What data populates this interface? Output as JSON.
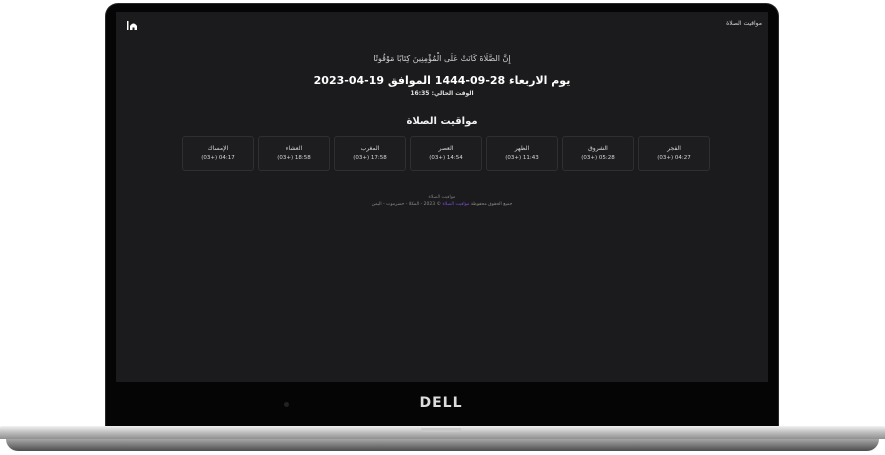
{
  "device": {
    "brand": "DELL"
  },
  "nav": {
    "title": "مواقيت الصلاة",
    "logo_icon": "mosque-icon"
  },
  "hero": {
    "verse": "إِنَّ الصَّلَاةَ كَانَتْ عَلَى الْمُؤْمِنِينَ كِتَابًا مَوْقُوتًا",
    "date": "يوم الاربعاء 28-09-1444 الموافق 19-04-2023",
    "current_time_label": "الوقت الحالي:",
    "current_time": "16:35"
  },
  "prayers": {
    "title": "مواقيت الصلاة",
    "items": [
      {
        "name": "الفجر",
        "time": "(03+) 04:27"
      },
      {
        "name": "الشروق",
        "time": "(03+) 05:28"
      },
      {
        "name": "الظهر",
        "time": "(03+) 11:43"
      },
      {
        "name": "العصر",
        "time": "(03+) 14:54"
      },
      {
        "name": "المغرب",
        "time": "(03+) 17:58"
      },
      {
        "name": "العشاء",
        "time": "(03+) 18:58"
      },
      {
        "name": "الإمساك",
        "time": "(03+) 04:17"
      }
    ]
  },
  "footer": {
    "site_name": "مواقيت الصلاة",
    "rights": "جميع الحقوق محفوظة",
    "link_text": "مواقيت الصلاة",
    "copyright": "© 2023 - المكلا - حضرموت - اليمن"
  }
}
